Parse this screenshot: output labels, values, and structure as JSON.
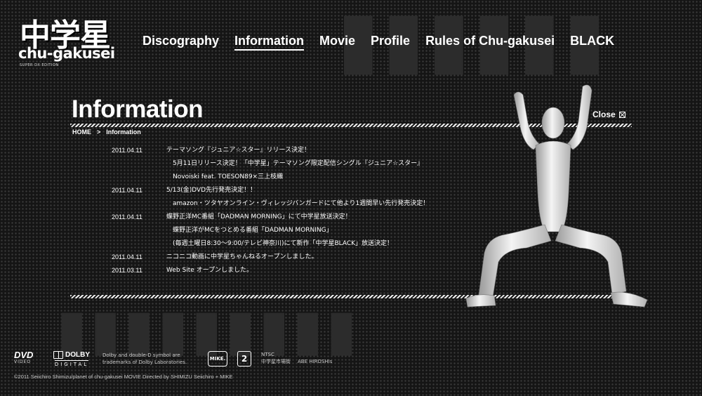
{
  "logo": {
    "kanji": "中学星",
    "roman": "chu-gakusei",
    "edition": "SUPER DX EDITION"
  },
  "nav": {
    "items": [
      {
        "label": "Discography",
        "active": false
      },
      {
        "label": "Information",
        "active": true
      },
      {
        "label": "Movie",
        "active": false
      },
      {
        "label": "Profile",
        "active": false
      },
      {
        "label": "Rules of Chu-gakusei",
        "active": false
      },
      {
        "label": "BLACK",
        "active": false
      }
    ]
  },
  "panel": {
    "title": "Information",
    "close_label": "Close",
    "breadcrumb": {
      "home": "HOME",
      "separator": ">",
      "current": "Information"
    }
  },
  "news": [
    {
      "date": "2011.04.11",
      "lines": [
        "テーマソング『ジュニア☆スター』リリース決定！",
        "5月11日リリース決定！「中学星」テーマソング限定配信シングル『ジュニア☆スター』",
        "Novoiski feat. TOESON89×三上枝織"
      ]
    },
    {
      "date": "2011.04.11",
      "lines": [
        "5/13(金)DVD先行発売決定！！",
        "amazon・ツタヤオンライン・ヴィレッジバンガードにて他より1週間早い先行発売決定！"
      ]
    },
    {
      "date": "2011.04.11",
      "lines": [
        "蝶野正洋MC番組「DADMAN MORNING」にて中学星放送決定！",
        "蝶野正洋がMCをつとめる番組「DADMAN MORNING」",
        "(毎週土曜日8:30～9:00/テレビ神奈川)にて新作「中学星BLACK」放送決定！"
      ]
    },
    {
      "date": "2011.04.11",
      "lines": [
        "ニコニコ動画に中学星ちゃんねるオープンしました。"
      ]
    },
    {
      "date": "2011.03.11",
      "lines": [
        "Web Site オープンしました。"
      ]
    }
  ],
  "footer": {
    "dvd_label": "DVD",
    "dvd_sub": "VIDEO",
    "dolby_word": "DOLBY",
    "dolby_digital": "DIGITAL",
    "dolby_note": "Dolby and double-D symbol are trademarks of Dolby Laboratories.",
    "mike_badge": "MIKE.",
    "region": "2",
    "ntsc": "NTSC",
    "location": "中学星市場街",
    "credit_name": "ABE HIROSHIs",
    "copyright": "©2011 Seiichiro Shimizu/planet of chu-gakusei  MOVIE Directed by SHIMIZU Seiichiro + MIKE"
  },
  "colors": {
    "background": "#151515",
    "text": "#ffffff",
    "halftone": "#3a3a3a"
  }
}
